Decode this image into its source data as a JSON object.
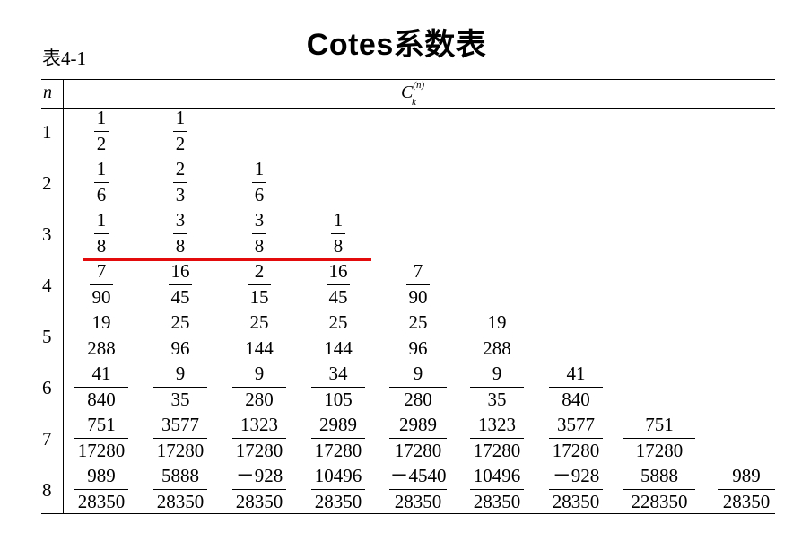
{
  "title": "Cotes系数表",
  "table_label": "表4-1",
  "header": {
    "n_label": "n",
    "coef_symbol": "C",
    "coef_sup": "(n)",
    "coef_sub": "k"
  },
  "rows": [
    {
      "n": "1",
      "terms": [
        [
          "1",
          "2"
        ],
        [
          "1",
          "2"
        ]
      ]
    },
    {
      "n": "2",
      "terms": [
        [
          "1",
          "6"
        ],
        [
          "2",
          "3"
        ],
        [
          "1",
          "6"
        ]
      ]
    },
    {
      "n": "3",
      "terms": [
        [
          "1",
          "8"
        ],
        [
          "3",
          "8"
        ],
        [
          "3",
          "8"
        ],
        [
          "1",
          "8"
        ]
      ]
    },
    {
      "n": "4",
      "terms": [
        [
          "7",
          "90"
        ],
        [
          "16",
          "45"
        ],
        [
          "2",
          "15"
        ],
        [
          "16",
          "45"
        ],
        [
          "7",
          "90"
        ]
      ]
    },
    {
      "n": "5",
      "terms": [
        [
          "19",
          "288"
        ],
        [
          "25",
          "96"
        ],
        [
          "25",
          "144"
        ],
        [
          "25",
          "144"
        ],
        [
          "25",
          "96"
        ],
        [
          "19",
          "288"
        ]
      ]
    },
    {
      "n": "6",
      "terms": [
        [
          "41",
          "840"
        ],
        [
          "9",
          "35"
        ],
        [
          "9",
          "280"
        ],
        [
          "34",
          "105"
        ],
        [
          "9",
          "280"
        ],
        [
          "9",
          "35"
        ],
        [
          "41",
          "840"
        ]
      ]
    },
    {
      "n": "7",
      "terms": [
        [
          "751",
          "17280"
        ],
        [
          "3577",
          "17280"
        ],
        [
          "1323",
          "17280"
        ],
        [
          "2989",
          "17280"
        ],
        [
          "2989",
          "17280"
        ],
        [
          "1323",
          "17280"
        ],
        [
          "3577",
          "17280"
        ],
        [
          "751",
          "17280"
        ]
      ]
    },
    {
      "n": "8",
      "terms": [
        [
          "989",
          "28350"
        ],
        [
          "5888",
          "28350"
        ],
        [
          "－928",
          "28350"
        ],
        [
          "10496",
          "28350"
        ],
        [
          "－4540",
          "28350"
        ],
        [
          "10496",
          "28350"
        ],
        [
          "－928",
          "28350"
        ],
        [
          "5888",
          "228350"
        ],
        [
          "989",
          "28350"
        ]
      ]
    }
  ],
  "annotation": {
    "underline_color": "#e30b0b"
  }
}
